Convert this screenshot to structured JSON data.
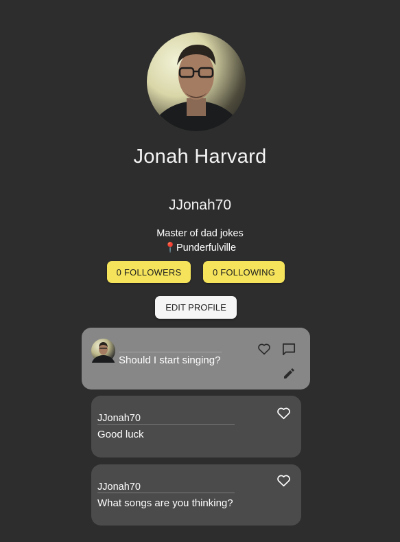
{
  "profile": {
    "name": "Jonah Harvard",
    "username": "JJonah70",
    "bio": "Master of dad jokes",
    "location": "📍Punderfulville",
    "followers_label": "0 FOLLOWERS",
    "following_label": "0 FOLLOWING",
    "edit_label": "EDIT PROFILE"
  },
  "post": {
    "text": "Should I start singing?",
    "icons": [
      "heart-icon",
      "comment-icon",
      "edit-pencil-icon"
    ]
  },
  "replies": [
    {
      "username": "JJonah70",
      "text": "Good luck",
      "icon": "heart-icon"
    },
    {
      "username": "JJonah70",
      "text": "What songs are you thinking?",
      "icon": "heart-icon"
    }
  ],
  "colors": {
    "background": "#2d2d2d",
    "pill": "#f4e35b",
    "post_card": "#878787",
    "reply_card": "#4b4b4b"
  }
}
